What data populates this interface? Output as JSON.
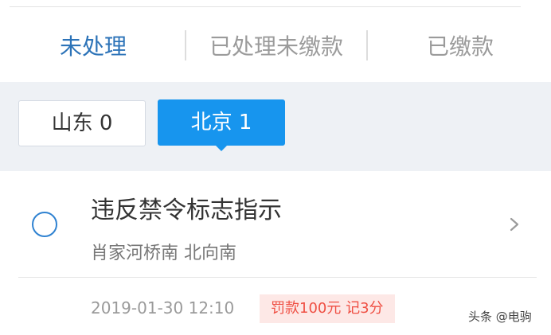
{
  "status_tabs": [
    {
      "label": "未处理",
      "active": true
    },
    {
      "label": "已处理未缴款",
      "active": false
    },
    {
      "label": "已缴款",
      "active": false
    }
  ],
  "regions": [
    {
      "label": "山东 0",
      "selected": false
    },
    {
      "label": "北京 1",
      "selected": true
    }
  ],
  "violation": {
    "title": "违反禁令标志指示",
    "location": "肖家河桥南 北向南",
    "datetime": "2019-01-30 12:10",
    "penalty": "罚款100元 记3分"
  },
  "watermark": "头条 @电驹",
  "colors": {
    "active_tab": "#2c73b8",
    "selected_region": "#1795ee",
    "penalty_text": "#ef4f43",
    "penalty_bg": "#fde8e6"
  },
  "icons": {
    "radio": "selection-circle-icon",
    "chevron": "chevron-right-icon"
  }
}
